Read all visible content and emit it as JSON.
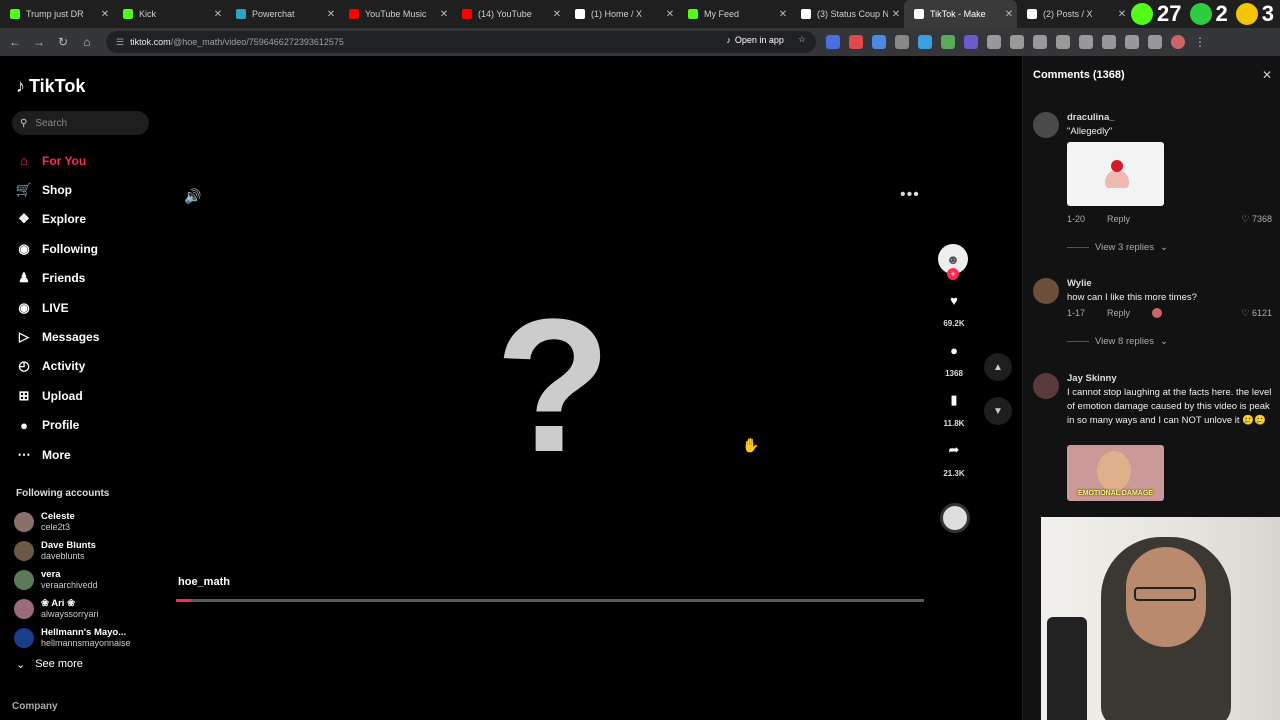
{
  "browser": {
    "tabs": [
      {
        "title": "Trump just DR",
        "color": "#53fc18",
        "active": false
      },
      {
        "title": "Kick",
        "color": "#53fc18",
        "active": false
      },
      {
        "title": "Powerchat",
        "color": "#2ba3c6",
        "active": false
      },
      {
        "title": "YouTube Music",
        "color": "#ff0000",
        "active": false
      },
      {
        "title": "(14) YouTube",
        "color": "#ff0000",
        "active": false
      },
      {
        "title": "(1) Home / X",
        "color": "#ffffff",
        "active": false
      },
      {
        "title": "My Feed",
        "color": "#53fc18",
        "active": false
      },
      {
        "title": "(3) Status Coup N",
        "color": "#ffffff",
        "active": false
      },
      {
        "title": "TikTok - Make",
        "color": "#ffffff",
        "active": true
      },
      {
        "title": "(2) Posts / X",
        "color": "#ffffff",
        "active": false
      }
    ],
    "overlay": {
      "left_num": "27",
      "right_num": "2",
      "far_num": "3"
    },
    "url_host": "tiktok.com",
    "url_path": "/@hoe_math/video/7596466272393612575",
    "open_in_app": "Open in app"
  },
  "sidebar": {
    "logo": "TikTok",
    "search_placeholder": "Search",
    "items": [
      {
        "label": "For You",
        "icon": "home-icon",
        "active": true
      },
      {
        "label": "Shop",
        "icon": "shop-icon"
      },
      {
        "label": "Explore",
        "icon": "compass-icon"
      },
      {
        "label": "Following",
        "icon": "following-avatar-icon"
      },
      {
        "label": "Friends",
        "icon": "friends-icon"
      },
      {
        "label": "LIVE",
        "icon": "live-icon"
      },
      {
        "label": "Messages",
        "icon": "messages-icon"
      },
      {
        "label": "Activity",
        "icon": "activity-icon"
      },
      {
        "label": "Upload",
        "icon": "upload-icon"
      },
      {
        "label": "Profile",
        "icon": "profile-icon"
      },
      {
        "label": "More",
        "icon": "more-icon"
      }
    ],
    "following_header": "Following accounts",
    "following": [
      {
        "name": "Celeste",
        "handle": "cele2t3",
        "color": "#8a6f6a"
      },
      {
        "name": "Dave Blunts",
        "handle": "daveblunts",
        "color": "#6b5a48"
      },
      {
        "name": "vera",
        "handle": "veraarchivedd",
        "color": "#5c7a5a"
      },
      {
        "name": "❀ Ari ❀",
        "handle": "alwayssorryari",
        "color": "#9a6b7a"
      },
      {
        "name": "Hellmann's Mayo...",
        "handle": "hellmannsmayonnaise",
        "color": "#1a3c8a"
      }
    ],
    "see_more": "See more",
    "company": "Company"
  },
  "video": {
    "author": "hoe_math",
    "progress": 0.02,
    "likes": "69.2K",
    "comments": "1368",
    "saves": "11.8K",
    "shares": "21.3K"
  },
  "comments_panel": {
    "title": "Comments (1368)",
    "items": [
      {
        "user": "draculina_",
        "text": "\"Allegedly\"",
        "date": "1-20",
        "reply": "Reply",
        "likes": "7368",
        "view_replies": "View 3 replies",
        "avatar_color": "#4a4a4a"
      },
      {
        "user": "Wylie",
        "text": "how can I like this more times?",
        "date": "1-17",
        "reply": "Reply",
        "likes": "6121",
        "view_replies": "View 8 replies",
        "avatar_color": "#6b4f3a"
      },
      {
        "user": "Jay Skinny",
        "text": "I cannot stop laughing at the facts here. the level of emotion damage caused by this video is peak in so many ways and I can NOT unlove it 🥲🥲",
        "image_caption": "EMOTIONAL DAMAGE",
        "avatar_color": "#5a3a3a"
      }
    ]
  }
}
